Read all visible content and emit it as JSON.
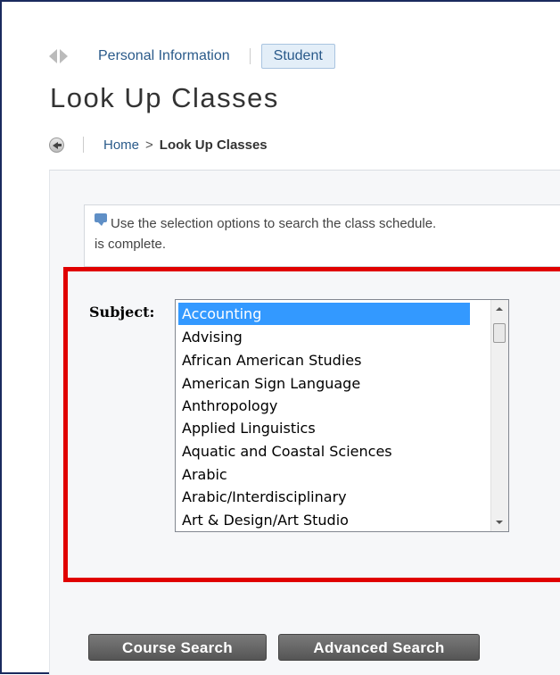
{
  "topnav": {
    "personal_info": "Personal Information",
    "student_tab": "Student"
  },
  "page_title": "Look Up Classes",
  "breadcrumb": {
    "home": "Home",
    "separator": ">",
    "current": "Look Up Classes"
  },
  "info": {
    "line1": "Use the selection options to search the class schedule. ",
    "line2": "is complete."
  },
  "subject": {
    "label": "Subject:",
    "options": [
      "Accounting",
      "Advising",
      "African American Studies",
      "American Sign Language",
      "Anthropology",
      "Applied Linguistics",
      "Aquatic and Coastal Sciences",
      "Arabic",
      "Arabic/Interdisciplinary",
      "Art & Design/Art Studio"
    ],
    "selected": "Accounting"
  },
  "buttons": {
    "course_search": "Course Search",
    "advanced_search": "Advanced Search"
  },
  "colors": {
    "highlight": "#e00000",
    "selection": "#3399ff",
    "link": "#2a5a8a"
  }
}
